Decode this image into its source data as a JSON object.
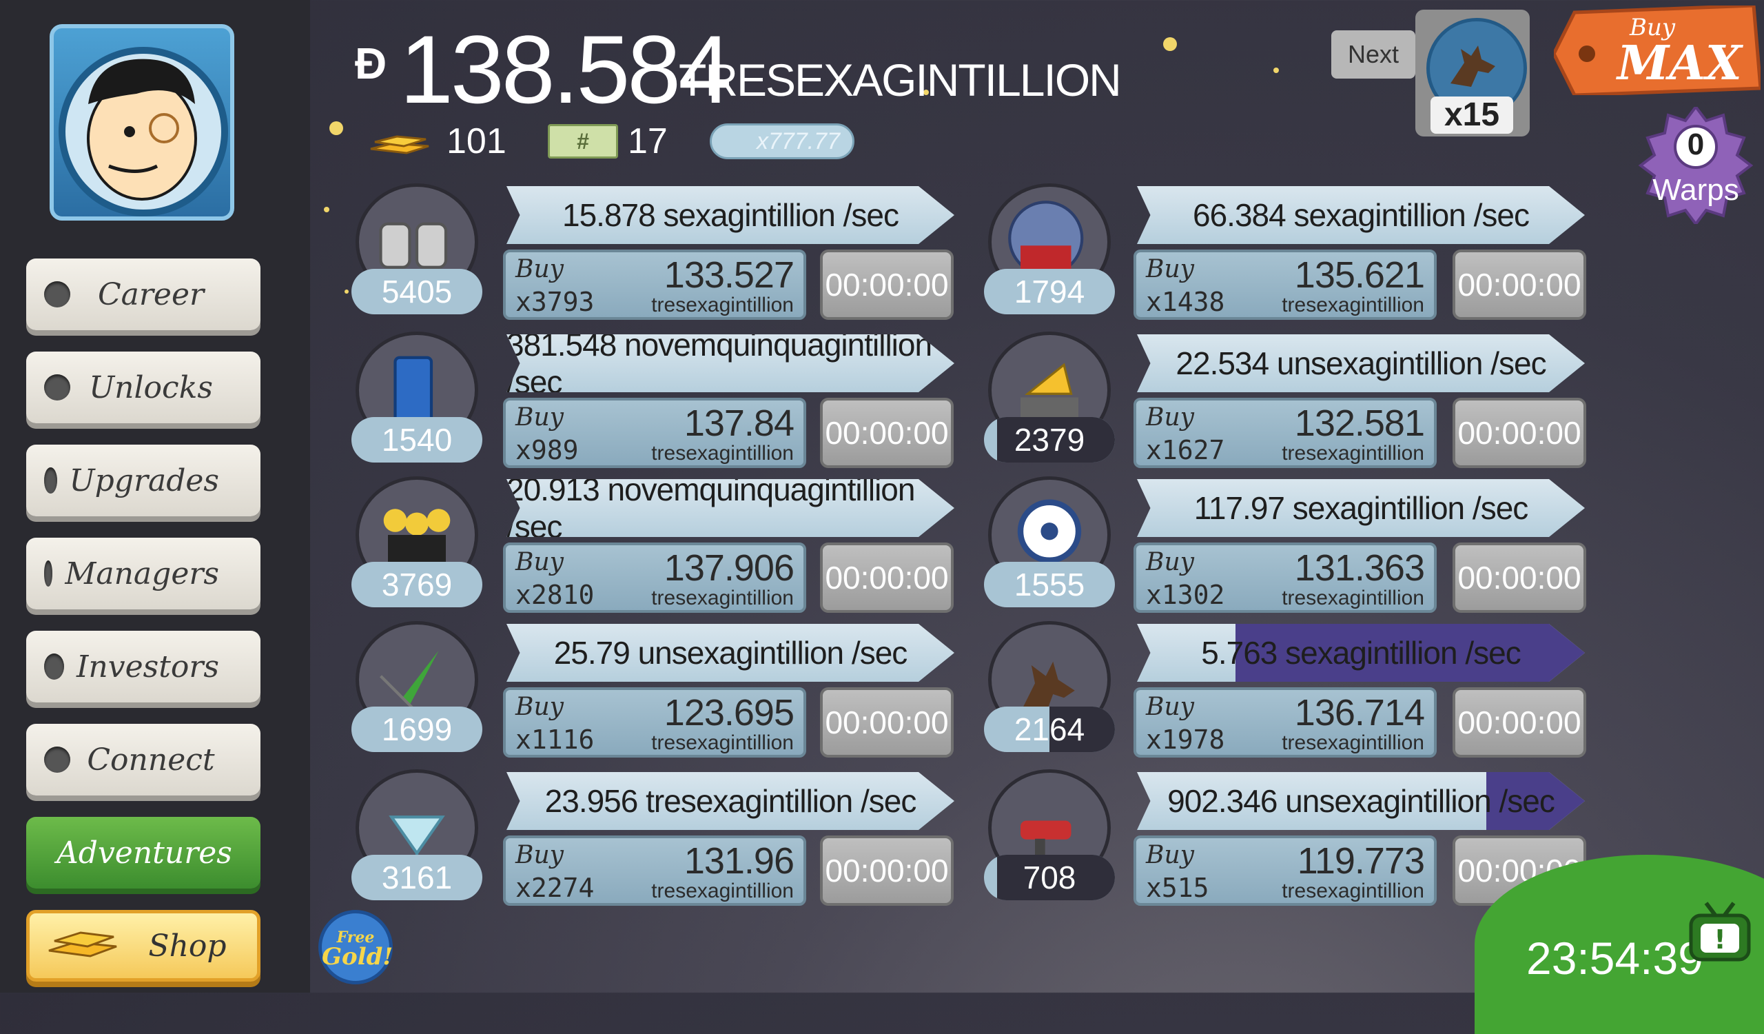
{
  "player": {
    "avatar_icon": "astronaut-avatar"
  },
  "menu": [
    {
      "label": "Career",
      "state": "normal"
    },
    {
      "label": "Unlocks",
      "state": "normal"
    },
    {
      "label": "Upgrades",
      "state": "normal"
    },
    {
      "label": "Managers",
      "state": "normal"
    },
    {
      "label": "Investors",
      "state": "normal"
    },
    {
      "label": "Connect",
      "state": "normal"
    },
    {
      "label": "Adventures",
      "state": "active"
    },
    {
      "label": "Shop",
      "state": "shop"
    }
  ],
  "header": {
    "currency_symbol": "Đ",
    "money_amount": "138.584",
    "money_unit": "TRESEXAGINTILLION",
    "gold_count": "101",
    "megaticket_count": "17",
    "multiplier_label": "x777.77"
  },
  "next_unlock": {
    "label": "Next",
    "multiplier": "x15",
    "icon": "werewolf-icon"
  },
  "buy_max": {
    "line1": "Buy",
    "line2": "MAX"
  },
  "warps": {
    "count": "0",
    "label": "Warps"
  },
  "free_gold": {
    "line1": "Free",
    "line2": "Gold!"
  },
  "clock": "23:54:39",
  "colors": {
    "banner": "#d9e6ee",
    "progress": "#4a3f8a",
    "active_tab": "#4ea33a",
    "shop": "#f5c95a",
    "hill": "#44a533"
  },
  "businesses": [
    {
      "icon": "moon-boots-icon",
      "count": "5405",
      "count_fill": 0.0,
      "rate": "15.878 sexagintillion /sec",
      "progress": 0.0,
      "buy_prefix": "Buy",
      "buy_qty": "x3793",
      "cost": "133.527",
      "cost_unit": "tresexagintillion",
      "timer": "00:00:00"
    },
    {
      "icon": "barn-dome-icon",
      "count": "1794",
      "count_fill": 0.0,
      "rate": "66.384 sexagintillion /sec",
      "progress": 0.0,
      "buy_prefix": "Buy",
      "buy_qty": "x1438",
      "cost": "135.621",
      "cost_unit": "tresexagintillion",
      "timer": "00:00:00"
    },
    {
      "icon": "phone-booth-icon",
      "count": "1540",
      "count_fill": 0.0,
      "rate": "381.548 novemquinquagintillion /sec",
      "progress": 0.0,
      "buy_prefix": "Buy",
      "buy_qty": "x989",
      "cost": "137.84",
      "cost_unit": "tresexagintillion",
      "timer": "00:00:00"
    },
    {
      "icon": "cheese-cart-icon",
      "count": "2379",
      "count_fill": 0.9,
      "rate": "22.534 unsexagintillion /sec",
      "progress": 0.0,
      "buy_prefix": "Buy",
      "buy_qty": "x1627",
      "cost": "132.581",
      "cost_unit": "tresexagintillion",
      "timer": "00:00:00"
    },
    {
      "icon": "alien-team-icon",
      "count": "3769",
      "count_fill": 0.0,
      "rate": "20.913 novemquinquagintillion /sec",
      "progress": 0.0,
      "buy_prefix": "Buy",
      "buy_qty": "x2810",
      "cost": "137.906",
      "cost_unit": "tresexagintillion",
      "timer": "00:00:00"
    },
    {
      "icon": "space-park-icon",
      "count": "1555",
      "count_fill": 0.0,
      "rate": "117.97 sexagintillion /sec",
      "progress": 0.0,
      "buy_prefix": "Buy",
      "buy_qty": "x1302",
      "cost": "131.363",
      "cost_unit": "tresexagintillion",
      "timer": "00:00:00"
    },
    {
      "icon": "rocket-icon",
      "count": "1699",
      "count_fill": 0.0,
      "rate": "25.79 unsexagintillion /sec",
      "progress": 0.0,
      "buy_prefix": "Buy",
      "buy_qty": "x1116",
      "cost": "123.695",
      "cost_unit": "tresexagintillion",
      "timer": "00:00:00"
    },
    {
      "icon": "werewolf-icon",
      "count": "2164",
      "count_fill": 0.5,
      "rate": "5.763 sexagintillion /sec",
      "progress": 0.78,
      "buy_prefix": "Buy",
      "buy_qty": "x1978",
      "cost": "136.714",
      "cost_unit": "tresexagintillion",
      "timer": "00:00:00"
    },
    {
      "icon": "cocktail-icon",
      "count": "3161",
      "count_fill": 0.0,
      "rate": "23.956 tresexagintillion /sec",
      "progress": 0.0,
      "buy_prefix": "Buy",
      "buy_qty": "x2274",
      "cost": "131.96",
      "cost_unit": "tresexagintillion",
      "timer": "00:00:00"
    },
    {
      "icon": "ray-gun-icon",
      "count": "708",
      "count_fill": 0.9,
      "rate": "902.346 unsexagintillion /sec",
      "progress": 0.22,
      "buy_prefix": "Buy",
      "buy_qty": "x515",
      "cost": "119.773",
      "cost_unit": "tresexagintillion",
      "timer": "00:00:00"
    }
  ]
}
